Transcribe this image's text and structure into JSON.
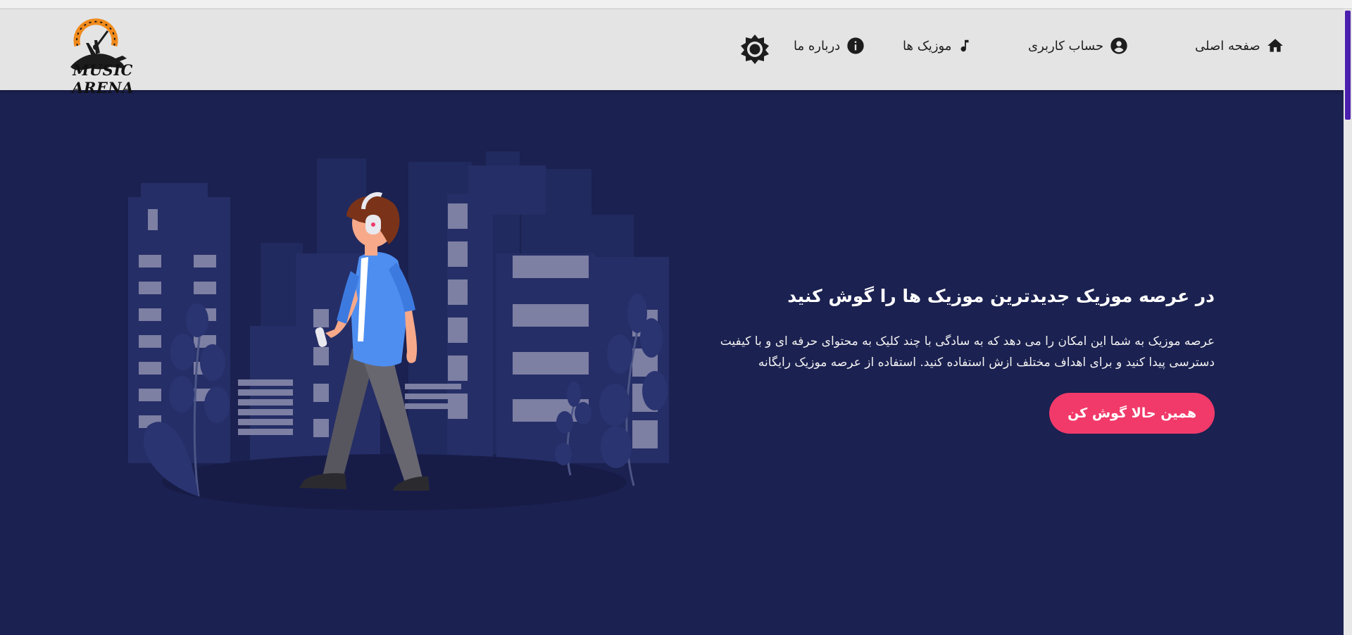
{
  "logo": {
    "text": "Music Arena"
  },
  "nav": {
    "home": "صفحه اصلی",
    "account": "حساب کاربری",
    "music": "موزیک ها",
    "about": "درباره ما"
  },
  "hero": {
    "title": "در عرصه موزیک جدیدترین موزیک ها را گوش کنید",
    "description": "عرصه موزیک به شما این امکان را می دهد که به سادگی با چند کلیک به محتوای حرفه ای و با کیفیت دسترسی پیدا کنید و برای اهداف مختلف ازش استفاده کنید. استفاده از عرصه موزیک رایگانه",
    "cta": "همین حالا گوش کن"
  },
  "colors": {
    "background": "#1b2150",
    "navbar": "#e4e4e4",
    "accent": "#f13a6a",
    "scroll_thumb": "#4b1fae"
  },
  "icons": [
    "home-icon",
    "account-circle-icon",
    "music-note-icon",
    "info-icon",
    "brightness-icon"
  ]
}
